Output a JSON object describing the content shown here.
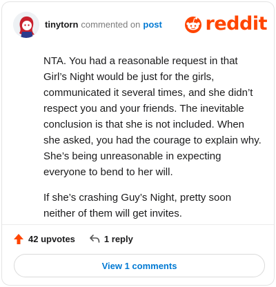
{
  "comment": {
    "username": "tinytorn",
    "action_text": "commented on",
    "post_link": "post",
    "brand": "reddit",
    "paragraphs": [
      "NTA. You had a reasonable request in that Girl’s Night would be just for the girls, communicated it several times, and she didn’t respect you and your friends. The inevitable conclusion is that she is not included. When she asked, you had the courage to explain why. She’s being unreasonable in expecting everyone to bend to her will.",
      "If she’s crashing Guy’s Night, pretty soon neither of them will get invites."
    ],
    "upvotes": "42 upvotes",
    "replies": "1 reply",
    "view_comments": "View 1 comments"
  },
  "icons": {
    "avatar": "avatar",
    "brand_logo": "reddit-alien-icon",
    "upvote": "upvote-arrow-icon",
    "reply": "reply-arrow-icon"
  },
  "colors": {
    "brand": "#ff4500",
    "link": "#0079d3",
    "upvote": "#ff4500"
  }
}
